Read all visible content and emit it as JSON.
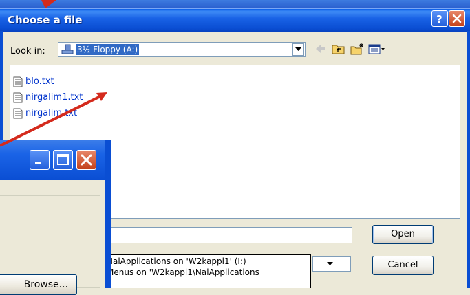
{
  "dialog": {
    "title": "Choose a file",
    "look_in_label": "Look in:",
    "look_in_value": "3½ Floppy (A:)",
    "files": [
      "blo.txt",
      "nirgalim1.txt",
      "nirgalim.txt"
    ],
    "filename_value": "",
    "filetype_options": [
      "NalApplications on 'W2kappl1' (I:)",
      "Menus on 'W2kappl1\\NalApplications"
    ],
    "open_label": "Open",
    "cancel_label": "Cancel"
  },
  "background_window": {
    "browse_label": "Browse..."
  },
  "colors": {
    "titlebar": "#0a4ed3",
    "accent_red": "#d42a1c",
    "selection": "#316ac5",
    "file_text": "#0033cc"
  },
  "icons": [
    "help-icon",
    "close-icon",
    "drive-icon",
    "back-arrow-icon",
    "up-folder-icon",
    "new-folder-icon",
    "view-menu-icon",
    "text-file-icon",
    "minimize-icon",
    "maximize-icon"
  ]
}
